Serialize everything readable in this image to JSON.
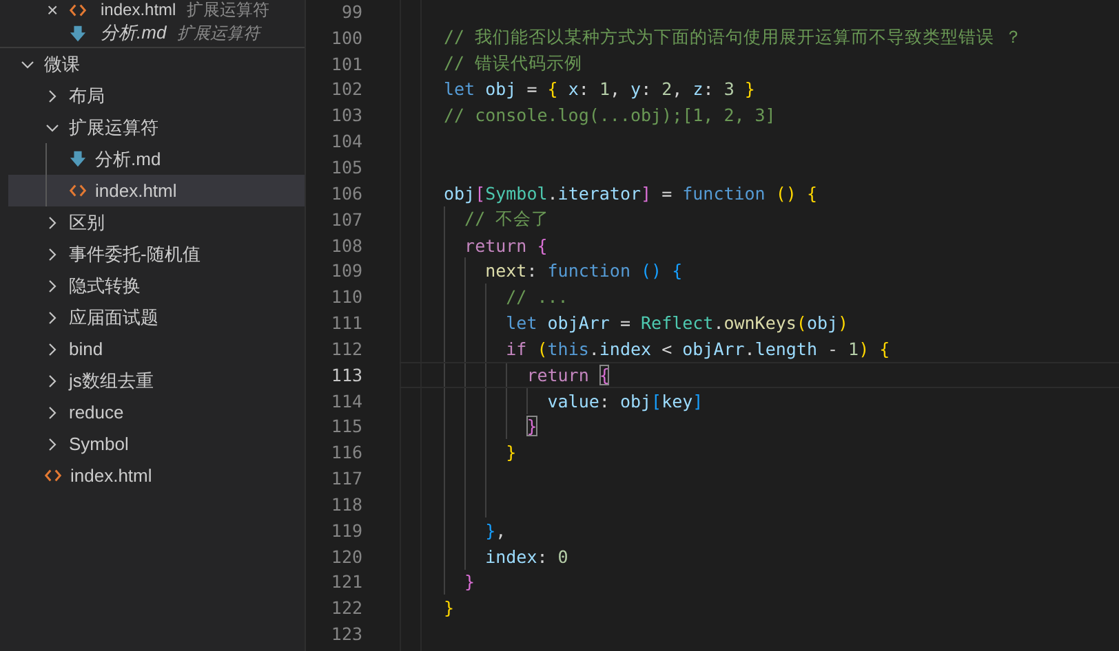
{
  "sidebar": {
    "open_editors": [
      {
        "name": "index.html",
        "description": "扩展运算符",
        "kind": "html",
        "preview": false,
        "close": "×"
      },
      {
        "name": "分析.md",
        "description": "扩展运算符",
        "kind": "md",
        "preview": true
      }
    ],
    "tree": [
      {
        "name": "微课",
        "kind": "folder",
        "expanded": true,
        "selected": false,
        "children": [
          {
            "name": "布局",
            "kind": "folder",
            "expanded": false,
            "selected": false
          },
          {
            "name": "扩展运算符",
            "kind": "folder",
            "expanded": true,
            "selected": false,
            "children": [
              {
                "name": "分析.md",
                "kind": "md",
                "selected": false
              },
              {
                "name": "index.html",
                "kind": "html",
                "selected": true
              }
            ]
          },
          {
            "name": "区别",
            "kind": "folder",
            "expanded": false,
            "selected": false
          },
          {
            "name": "事件委托-随机值",
            "kind": "folder",
            "expanded": false,
            "selected": false
          },
          {
            "name": "隐式转换",
            "kind": "folder",
            "expanded": false,
            "selected": false
          },
          {
            "name": "应届面试题",
            "kind": "folder",
            "expanded": false,
            "selected": false
          },
          {
            "name": "bind",
            "kind": "folder",
            "expanded": false,
            "selected": false
          },
          {
            "name": "js数组去重",
            "kind": "folder",
            "expanded": false,
            "selected": false
          },
          {
            "name": "reduce",
            "kind": "folder",
            "expanded": false,
            "selected": false
          },
          {
            "name": "Symbol",
            "kind": "folder",
            "expanded": false,
            "selected": false
          },
          {
            "name": "index.html",
            "kind": "html",
            "selected": false
          }
        ]
      }
    ]
  },
  "editor": {
    "lines": [
      {
        "n": "99",
        "current": false
      },
      {
        "n": "100",
        "current": false,
        "tokens": [
          {
            "t": "// 我们能否以某种方式为下面的语句使用展开运算而不导致类型错误 ？",
            "color": "#6a9955",
            "match": false
          }
        ]
      },
      {
        "n": "101",
        "current": false,
        "tokens": [
          {
            "t": "// 错误代码示例",
            "color": "#6a9955",
            "match": false
          }
        ]
      },
      {
        "n": "102",
        "current": false,
        "tokens": [
          {
            "t": "let ",
            "color": "#569cd6",
            "match": false
          },
          {
            "t": "obj ",
            "color": "#9cdcfe",
            "match": false
          },
          {
            "t": "= ",
            "color": "#d4d4d4",
            "match": false
          },
          {
            "t": "{",
            "color": "#ffd700",
            "match": false
          },
          {
            "t": " x",
            "color": "#9cdcfe",
            "match": false
          },
          {
            "t": ": ",
            "color": "#d4d4d4",
            "match": false
          },
          {
            "t": "1",
            "color": "#b5cea8",
            "match": false
          },
          {
            "t": ", ",
            "color": "#d4d4d4",
            "match": false
          },
          {
            "t": "y",
            "color": "#9cdcfe",
            "match": false
          },
          {
            "t": ": ",
            "color": "#d4d4d4",
            "match": false
          },
          {
            "t": "2",
            "color": "#b5cea8",
            "match": false
          },
          {
            "t": ", ",
            "color": "#d4d4d4",
            "match": false
          },
          {
            "t": "z",
            "color": "#9cdcfe",
            "match": false
          },
          {
            "t": ": ",
            "color": "#d4d4d4",
            "match": false
          },
          {
            "t": "3 ",
            "color": "#b5cea8",
            "match": false
          },
          {
            "t": "}",
            "color": "#ffd700",
            "match": false
          }
        ]
      },
      {
        "n": "103",
        "current": false,
        "tokens": [
          {
            "t": "// console.log(...obj);[1, 2, 3]",
            "color": "#6a9955",
            "match": false
          }
        ]
      },
      {
        "n": "104",
        "current": false
      },
      {
        "n": "105",
        "current": false
      },
      {
        "n": "106",
        "current": false,
        "tokens": [
          {
            "t": "obj",
            "color": "#9cdcfe",
            "match": false
          },
          {
            "t": "[",
            "color": "#da70d6",
            "match": false
          },
          {
            "t": "Symbol",
            "color": "#4ec9b0",
            "match": false
          },
          {
            "t": ".",
            "color": "#d4d4d4",
            "match": false
          },
          {
            "t": "iterator",
            "color": "#9cdcfe",
            "match": false
          },
          {
            "t": "]",
            "color": "#da70d6",
            "match": false
          },
          {
            "t": " = ",
            "color": "#d4d4d4",
            "match": false
          },
          {
            "t": "function ",
            "color": "#569cd6",
            "match": false
          },
          {
            "t": "() ",
            "color": "#ffd700",
            "match": false
          },
          {
            "t": "{",
            "color": "#ffd700",
            "match": false
          }
        ]
      },
      {
        "n": "107",
        "current": false,
        "tokens": [
          {
            "t": "  // 不会了",
            "color": "#6a9955",
            "match": false
          }
        ]
      },
      {
        "n": "108",
        "current": false,
        "tokens": [
          {
            "t": "  return ",
            "color": "#c586c0",
            "match": false
          },
          {
            "t": "{",
            "color": "#da70d6",
            "match": false
          }
        ]
      },
      {
        "n": "109",
        "current": false,
        "tokens": [
          {
            "t": "    next",
            "color": "#dcdcaa",
            "match": false
          },
          {
            "t": ": ",
            "color": "#d4d4d4",
            "match": false
          },
          {
            "t": "function ",
            "color": "#569cd6",
            "match": false
          },
          {
            "t": "() ",
            "color": "#179fff",
            "match": false
          },
          {
            "t": "{",
            "color": "#179fff",
            "match": false
          }
        ]
      },
      {
        "n": "110",
        "current": false,
        "tokens": [
          {
            "t": "      // ...",
            "color": "#6a9955",
            "match": false
          }
        ]
      },
      {
        "n": "111",
        "current": false,
        "tokens": [
          {
            "t": "      let ",
            "color": "#569cd6",
            "match": false
          },
          {
            "t": "objArr ",
            "color": "#9cdcfe",
            "match": false
          },
          {
            "t": "= ",
            "color": "#d4d4d4",
            "match": false
          },
          {
            "t": "Reflect",
            "color": "#4ec9b0",
            "match": false
          },
          {
            "t": ".",
            "color": "#d4d4d4",
            "match": false
          },
          {
            "t": "ownKeys",
            "color": "#dcdcaa",
            "match": false
          },
          {
            "t": "(",
            "color": "#ffd700",
            "match": false
          },
          {
            "t": "obj",
            "color": "#9cdcfe",
            "match": false
          },
          {
            "t": ")",
            "color": "#ffd700",
            "match": false
          }
        ]
      },
      {
        "n": "112",
        "current": false,
        "tokens": [
          {
            "t": "      if ",
            "color": "#c586c0",
            "match": false
          },
          {
            "t": "(",
            "color": "#ffd700",
            "match": false
          },
          {
            "t": "this",
            "color": "#569cd6",
            "match": false
          },
          {
            "t": ".",
            "color": "#d4d4d4",
            "match": false
          },
          {
            "t": "index",
            "color": "#9cdcfe",
            "match": false
          },
          {
            "t": " < ",
            "color": "#d4d4d4",
            "match": false
          },
          {
            "t": "objArr",
            "color": "#9cdcfe",
            "match": false
          },
          {
            "t": ".",
            "color": "#d4d4d4",
            "match": false
          },
          {
            "t": "length",
            "color": "#9cdcfe",
            "match": false
          },
          {
            "t": " - ",
            "color": "#d4d4d4",
            "match": false
          },
          {
            "t": "1",
            "color": "#b5cea8",
            "match": false
          },
          {
            "t": ") ",
            "color": "#ffd700",
            "match": false
          },
          {
            "t": "{",
            "color": "#ffd700",
            "match": false
          }
        ]
      },
      {
        "n": "113",
        "current": true,
        "tokens": [
          {
            "t": "        return ",
            "color": "#c586c0",
            "match": false
          },
          {
            "t": "{",
            "color": "#da70d6",
            "match": true
          }
        ]
      },
      {
        "n": "114",
        "current": false,
        "tokens": [
          {
            "t": "          value",
            "color": "#9cdcfe",
            "match": false
          },
          {
            "t": ": ",
            "color": "#d4d4d4",
            "match": false
          },
          {
            "t": "obj",
            "color": "#9cdcfe",
            "match": false
          },
          {
            "t": "[",
            "color": "#179fff",
            "match": false
          },
          {
            "t": "key",
            "color": "#9cdcfe",
            "match": false
          },
          {
            "t": "]",
            "color": "#179fff",
            "match": false
          }
        ]
      },
      {
        "n": "115",
        "current": false,
        "tokens": [
          {
            "t": "        }",
            "color": "#da70d6",
            "match": true
          }
        ]
      },
      {
        "n": "116",
        "current": false,
        "tokens": [
          {
            "t": "      }",
            "color": "#ffd700",
            "match": false
          }
        ]
      },
      {
        "n": "117",
        "current": false
      },
      {
        "n": "118",
        "current": false
      },
      {
        "n": "119",
        "current": false,
        "tokens": [
          {
            "t": "    }",
            "color": "#179fff",
            "match": false
          },
          {
            "t": ",",
            "color": "#d4d4d4",
            "match": false
          }
        ]
      },
      {
        "n": "120",
        "current": false,
        "tokens": [
          {
            "t": "    index",
            "color": "#9cdcfe",
            "match": false
          },
          {
            "t": ": ",
            "color": "#d4d4d4",
            "match": false
          },
          {
            "t": "0",
            "color": "#b5cea8",
            "match": false
          }
        ]
      },
      {
        "n": "121",
        "current": false,
        "tokens": [
          {
            "t": "  }",
            "color": "#da70d6",
            "match": false
          }
        ]
      },
      {
        "n": "122",
        "current": false,
        "tokens": [
          {
            "t": "}",
            "color": "#ffd700",
            "match": false
          }
        ]
      },
      {
        "n": "123",
        "current": false
      }
    ]
  }
}
